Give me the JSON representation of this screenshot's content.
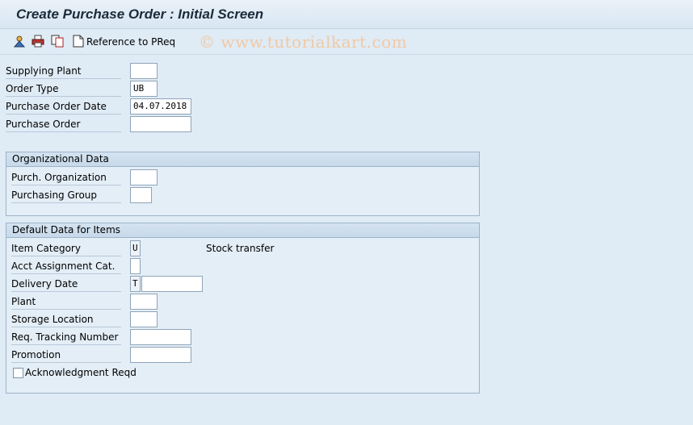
{
  "window": {
    "title": "Create Purchase Order : Initial Screen"
  },
  "toolbar": {
    "icons": [
      "person-icon",
      "print-icon",
      "copy-icon",
      "document-icon"
    ],
    "reference_label": "Reference to PReq",
    "watermark": "© www.tutorialkart.com"
  },
  "header_fields": {
    "supplying_plant": {
      "label": "Supplying Plant",
      "value": ""
    },
    "order_type": {
      "label": "Order Type",
      "value": "UB"
    },
    "po_date": {
      "label": "Purchase Order Date",
      "value": "04.07.2018"
    },
    "purchase_order": {
      "label": "Purchase Order",
      "value": ""
    }
  },
  "org_data": {
    "title": "Organizational Data",
    "purch_org": {
      "label": "Purch. Organization",
      "value": ""
    },
    "purch_group": {
      "label": "Purchasing Group",
      "value": ""
    }
  },
  "default_data": {
    "title": "Default Data for Items",
    "item_category": {
      "label": "Item Category",
      "value": "U",
      "text": "Stock transfer"
    },
    "acct_assignment": {
      "label": "Acct Assignment Cat.",
      "value": ""
    },
    "delivery_date": {
      "label": "Delivery Date",
      "type_value": "T",
      "value": ""
    },
    "plant": {
      "label": "Plant",
      "value": ""
    },
    "storage_location": {
      "label": "Storage Location",
      "value": ""
    },
    "tracking_number": {
      "label": "Req. Tracking Number",
      "value": ""
    },
    "promotion": {
      "label": "Promotion",
      "value": ""
    },
    "acknowledgment": {
      "label": "Acknowledgment Reqd",
      "checked": false
    }
  }
}
